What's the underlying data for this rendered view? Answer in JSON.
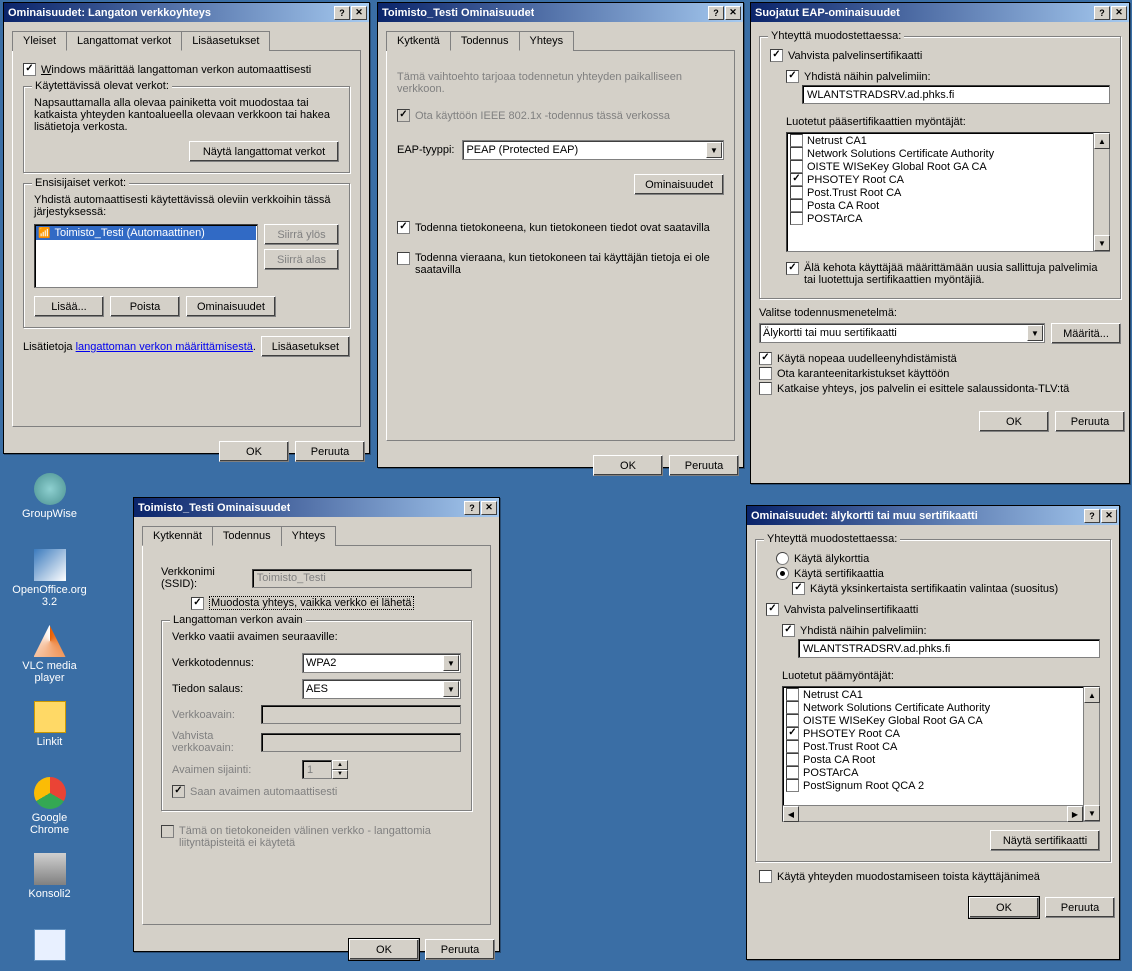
{
  "desktop_icons": [
    {
      "label": "GroupWise"
    },
    {
      "label": "OpenOffice.org 3.2"
    },
    {
      "label": "VLC media player"
    },
    {
      "label": "Linkit"
    },
    {
      "label": "Google Chrome"
    },
    {
      "label": "Konsoli2"
    },
    {
      "label": ""
    }
  ],
  "win1": {
    "title": "Ominaisuudet: Langaton verkkoyhteys",
    "tabs": [
      "Yleiset",
      "Langattomat verkot",
      "Lisäasetukset"
    ],
    "auto_label": "Windows määrittää langattoman verkon automaattisesti",
    "available_title": "Käytettävissä olevat verkot:",
    "available_text": "Napsauttamalla alla olevaa painiketta voit muodostaa tai katkaista yhteyden kantoalueella olevaan verkkoon tai hakea lisätietoja verkosta.",
    "show_btn": "Näytä langattomat verkot",
    "pref_title": "Ensisijaiset verkot:",
    "pref_text": "Yhdistä automaattisesti käytettävissä oleviin verkkoihin tässä järjestyksessä:",
    "list_item": "Toimisto_Testi (Automaattinen)",
    "move_up": "Siirrä ylös",
    "move_down": "Siirrä alas",
    "add": "Lisää...",
    "remove": "Poista",
    "props": "Ominaisuudet",
    "info_text": "Lisätietoja ",
    "info_link": "langattoman verkon määrittämisestä",
    "advanced": "Lisäasetukset",
    "ok": "OK",
    "cancel": "Peruuta"
  },
  "win2": {
    "title": "Toimisto_Testi Ominaisuudet",
    "tabs": [
      "Kytkentä",
      "Todennus",
      "Yhteys"
    ],
    "desc": "Tämä vaihtoehto tarjoaa todennetun yhteyden paikalliseen verkkoon.",
    "ieee_label": "Ota käyttöön IEEE 802.1x -todennus tässä verkossa",
    "eap_label": "EAP-tyyppi:",
    "eap_value": "PEAP (Protected EAP)",
    "props": "Ominaisuudet",
    "auth_computer": "Todenna tietokoneena, kun tietokoneen tiedot ovat saatavilla",
    "auth_guest": "Todenna vieraana, kun tietokoneen tai käyttäjän tietoja ei ole saatavilla",
    "ok": "OK",
    "cancel": "Peruuta"
  },
  "win3": {
    "title": "Suojatut EAP-ominaisuudet",
    "connect_title": "Yhteyttä muodostettaessa:",
    "validate_cert": "Vahvista palvelinsertifikaatti",
    "connect_servers": "Yhdistä näihin palvelimiin:",
    "server_value": "WLANTSTRADSRV.ad.phks.fi",
    "ca_title": "Luotetut pääsertifikaattien myöntäjät:",
    "ca_list": [
      {
        "name": "Netrust CA1",
        "checked": false
      },
      {
        "name": "Network Solutions Certificate Authority",
        "checked": false
      },
      {
        "name": "OISTE WISeKey Global Root GA CA",
        "checked": false
      },
      {
        "name": "PHSOTEY Root CA",
        "checked": true
      },
      {
        "name": "Post.Trust Root CA",
        "checked": false
      },
      {
        "name": "Posta CA Root",
        "checked": false
      },
      {
        "name": "POSTArCA",
        "checked": false
      }
    ],
    "no_prompt": "Älä kehota käyttäjää määrittämään uusia sallittuja palvelimia tai luotettuja sertifikaattien myöntäjiä.",
    "auth_method_label": "Valitse todennusmenetelmä:",
    "auth_method_value": "Älykortti tai muu sertifikaatti",
    "configure": "Määritä...",
    "fast_reconnect": "Käytä nopeaa uudelleenyhdistämistä",
    "quarantine": "Ota karanteenitarkistukset käyttöön",
    "disconnect_tlv": "Katkaise yhteys, jos palvelin ei esittele salaussidonta-TLV:tä",
    "ok": "OK",
    "cancel": "Peruuta"
  },
  "win4": {
    "title": "Toimisto_Testi Ominaisuudet",
    "tabs": [
      "Kytkennät",
      "Todennus",
      "Yhteys"
    ],
    "ssid_label": "Verkkonimi (SSID):",
    "ssid_value": "Toimisto_Testi",
    "connect_even": "Muodosta yhteys, vaikka verkko ei lähetä",
    "key_title": "Langattoman verkon avain",
    "key_desc": "Verkko vaatii avaimen seuraaville:",
    "auth_label": "Verkkotodennus:",
    "auth_value": "WPA2",
    "enc_label": "Tiedon salaus:",
    "enc_value": "AES",
    "netkey": "Verkkoavain:",
    "confirm": "Vahvista verkkoavain:",
    "keyindex": "Avaimen sijainti:",
    "keyindex_value": "1",
    "autokey": "Saan avaimen automaattisesti",
    "adhoc": "Tämä on tietokoneiden välinen verkko - langattomia liityntäpisteitä ei käytetä",
    "ok": "OK",
    "cancel": "Peruuta"
  },
  "win5": {
    "title": "Ominaisuudet: älykortti tai muu sertifikaatti",
    "connect_title": "Yhteyttä muodostettaessa:",
    "use_smartcard": "Käytä älykorttia",
    "use_cert": "Käytä sertifikaattia",
    "use_simple": "Käytä yksinkertaista sertifikaatin valintaa (suositus)",
    "validate_cert": "Vahvista palvelinsertifikaatti",
    "connect_servers": "Yhdistä näihin palvelimiin:",
    "server_value": "WLANTSTRADSRV.ad.phks.fi",
    "ca_title": "Luotetut päämyöntäjät:",
    "ca_list": [
      {
        "name": "Netrust CA1",
        "checked": false
      },
      {
        "name": "Network Solutions Certificate Authority",
        "checked": false
      },
      {
        "name": "OISTE WISeKey Global Root GA CA",
        "checked": false
      },
      {
        "name": "PHSOTEY Root CA",
        "checked": true
      },
      {
        "name": "Post.Trust Root CA",
        "checked": false
      },
      {
        "name": "Posta CA Root",
        "checked": false
      },
      {
        "name": "POSTArCA",
        "checked": false
      },
      {
        "name": "PostSignum Root QCA 2",
        "checked": false
      }
    ],
    "show_cert": "Näytä sertifikaatti",
    "diff_user": "Käytä yhteyden muodostamiseen toista käyttäjänimeä",
    "ok": "OK",
    "cancel": "Peruuta"
  }
}
